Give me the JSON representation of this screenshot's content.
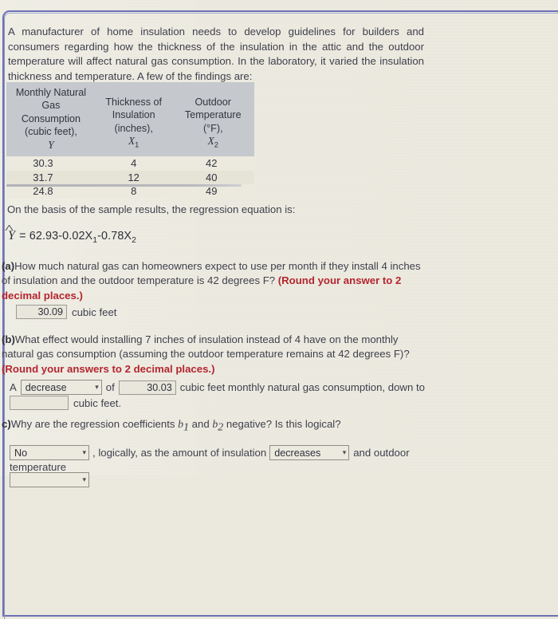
{
  "problem": {
    "intro": "A manufacturer of home insulation needs to develop guidelines for builders and consumers regarding how the thickness of the insulation in the attic and the outdoor temperature will affect natural gas consumption. In the laboratory, it varied the insulation thickness and temperature. A few of the findings are:"
  },
  "table": {
    "headers": [
      "Monthly Natural Gas Consumption (cubic feet), Y",
      "Thickness of Insulation (inches), X1",
      "Outdoor Temperature (°F), X2"
    ],
    "header_lines": {
      "col1": [
        "Monthly Natural",
        "Gas",
        "Consumption",
        "(cubic feet),",
        "Y"
      ],
      "col2": [
        "Thickness of",
        "Insulation",
        "(inches),",
        "X",
        "1"
      ],
      "col3": [
        "Outdoor",
        "Temperature",
        "(°F),",
        "X",
        "2"
      ]
    },
    "rows": [
      {
        "y": "30.3",
        "x1": "4",
        "x2": "42"
      },
      {
        "y": "31.7",
        "x1": "12",
        "x2": "40"
      },
      {
        "y": "24.8",
        "x1": "8",
        "x2": "49"
      }
    ]
  },
  "regression": {
    "lead_in": "On the basis of the sample results, the regression equation is:",
    "yhat_symbol": "Y",
    "equals": "=",
    "intercept": "62.93",
    "term1": "-0.02X",
    "term1_sub": "1",
    "term2": "-0.78X",
    "term2_sub": "2"
  },
  "questions": {
    "a": {
      "label": "(a)",
      "text": "How much natural gas can homeowners expect to use per month if they install 4 inches of insulation and the outdoor temperature is 42 degrees F? ",
      "instruction": "(Round your answer to 2 decimal places.)",
      "answer_value": "30.09",
      "answer_unit": "cubic feet"
    },
    "b": {
      "label": "(b)",
      "text": "What effect would installing 7 inches of insulation instead of 4 have on the monthly natural gas consumption (assuming the outdoor temperature remains at 42 degrees F)? ",
      "instruction": "(Round your answers to 2 decimal places.)",
      "prefix": "A",
      "effect_select": "decrease",
      "mid_text": "of",
      "amount_value": "30.03",
      "suffix_text": "cubic feet monthly natural gas consumption, down to",
      "final_value": "",
      "final_unit": "cubic feet."
    },
    "c": {
      "label": "c)",
      "text_part1": "Why are the regression coefficients ",
      "b1": "b",
      "b1_sub": "1",
      "text_and": " and ",
      "b2": "b",
      "b2_sub": "2",
      "text_part2": " negative? Is this logical?",
      "logical_select": "No",
      "mid_text": ", logically, as the amount of insulation",
      "insulation_select": "decreases",
      "tail_text": "and outdoor",
      "tail_text2": "temperature",
      "bottom_select": ""
    }
  },
  "icons": {
    "dropdown_caret": "⌄"
  },
  "colors": {
    "page_background": "#eceadf",
    "frame_border": "#6b72b5",
    "table_header_bg": "#c5c8cc",
    "instruction_red": "#b4252f",
    "text": "#3e3f4c",
    "input_border": "#9b9a93"
  }
}
